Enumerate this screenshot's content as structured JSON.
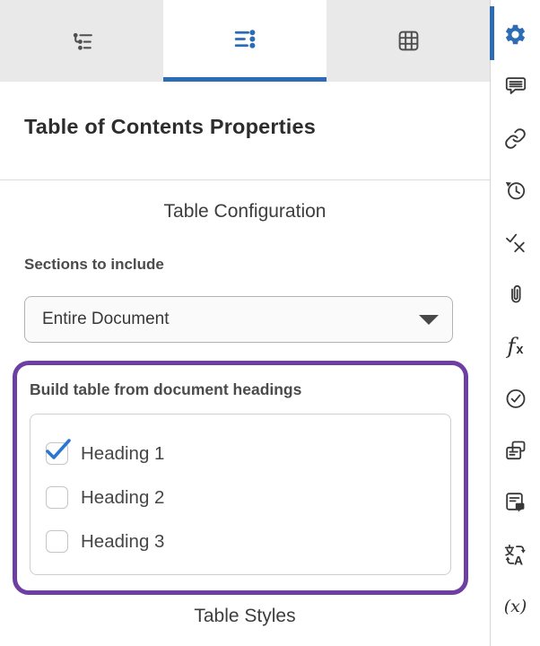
{
  "colors": {
    "accent_blue": "#2b6cb5",
    "check_blue": "#2b77d0",
    "highlight_purple": "#6e3fa3",
    "tab_bar_gray": "#e9e9e9"
  },
  "tab_bar": {
    "tabs": [
      {
        "icon": "outline-tree-icon",
        "active": false
      },
      {
        "icon": "bulleted-list-icon",
        "active": true
      },
      {
        "icon": "table-grid-icon",
        "active": false
      }
    ]
  },
  "right_toolbar": {
    "items": [
      {
        "icon": "gear-icon",
        "active": true
      },
      {
        "icon": "comment-icon",
        "active": false
      },
      {
        "icon": "link-icon",
        "active": false
      },
      {
        "icon": "history-icon",
        "active": false
      },
      {
        "icon": "review-check-x-icon",
        "active": false
      },
      {
        "icon": "paperclip-icon",
        "active": false
      },
      {
        "icon": "function-fx-icon",
        "active": false
      },
      {
        "icon": "circled-check-icon",
        "active": false
      },
      {
        "icon": "copies-icon",
        "active": false
      },
      {
        "icon": "document-comment-icon",
        "active": false
      },
      {
        "icon": "translate-icon",
        "active": false
      },
      {
        "icon": "variables-icon",
        "active": false
      }
    ]
  },
  "icons": {
    "fx_f": "f",
    "fx_x": "x",
    "translate_letter": "A",
    "variables_label": "(x)"
  },
  "panel": {
    "title": "Table of Contents Properties",
    "table_configuration": {
      "section_title": "Table Configuration",
      "sections_to_include": {
        "label": "Sections to include",
        "dropdown_value": "Entire Document"
      },
      "headings_group": {
        "label": "Build table from document headings",
        "options": [
          {
            "label": "Heading 1",
            "checked": true
          },
          {
            "label": "Heading 2",
            "checked": false
          },
          {
            "label": "Heading 3",
            "checked": false
          }
        ]
      }
    },
    "table_styles": {
      "section_title": "Table Styles"
    }
  }
}
